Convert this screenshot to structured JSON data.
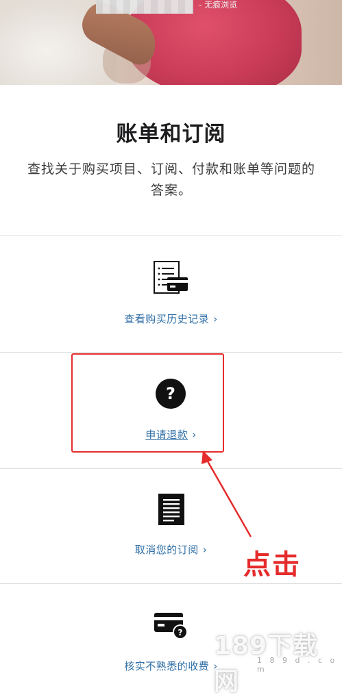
{
  "hero": {
    "incognito_text": "- 无痕浏览"
  },
  "page": {
    "title": "账单和订阅",
    "description": "查找关于购买项目、订阅、付款和账单等问题的答案。"
  },
  "sections": [
    {
      "label": "查看购买历史记录",
      "chevron": "›",
      "icon": "receipt-card-icon"
    },
    {
      "label": "申请退款",
      "chevron": "›",
      "icon": "question-circle-icon"
    },
    {
      "label": "取消您的订阅",
      "chevron": "›",
      "icon": "document-icon"
    },
    {
      "label": "核实不熟悉的收费",
      "chevron": "›",
      "icon": "card-question-icon"
    }
  ],
  "annotation": {
    "label": "点击",
    "color": "#e52b2b"
  },
  "watermark": {
    "text": "189下载网",
    "sub": "1 8 9 d . c o m"
  }
}
